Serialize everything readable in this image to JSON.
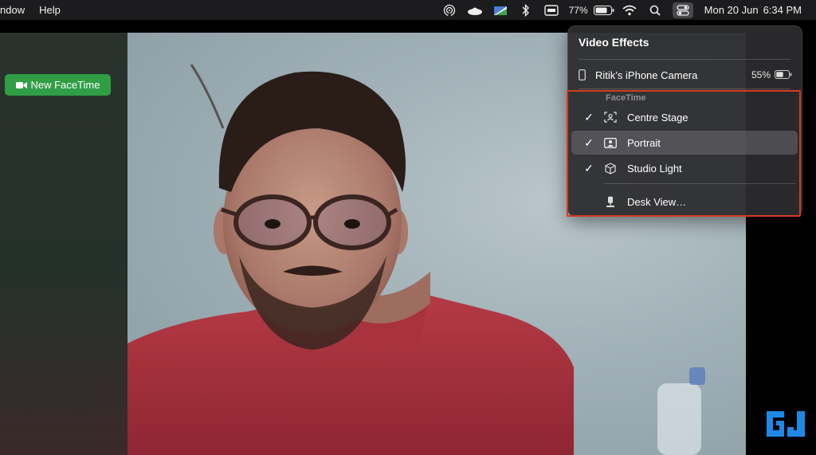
{
  "menubar": {
    "items": [
      "ndow",
      "Help"
    ],
    "battery_percent": "77%",
    "date": "Mon 20 Jun",
    "time": "6:34 PM",
    "icons": [
      "airdrop-icon",
      "ufo-icon",
      "keyboard-flag-icon",
      "bluetooth-icon",
      "display-icon",
      "battery-icon",
      "wifi-icon",
      "spotlight-icon",
      "control-center-icon"
    ]
  },
  "sidebar": {
    "new_facetime_label": "New FaceTime"
  },
  "video_effects": {
    "title": "Video Effects",
    "camera_name": "Ritik’s iPhone Camera",
    "camera_battery": "55%",
    "section_label": "FaceTime",
    "effects": [
      {
        "label": "Centre Stage",
        "checked": true,
        "icon": "centre-stage-icon"
      },
      {
        "label": "Portrait",
        "checked": true,
        "icon": "portrait-icon",
        "selected": true
      },
      {
        "label": "Studio Light",
        "checked": true,
        "icon": "cube-icon"
      },
      {
        "label": "Desk View…",
        "checked": false,
        "icon": "desk-view-icon"
      }
    ]
  },
  "colors": {
    "accent_green": "#2f9e45",
    "highlight_red": "#d63a1e",
    "panel_bg": "#2c2c2e"
  }
}
